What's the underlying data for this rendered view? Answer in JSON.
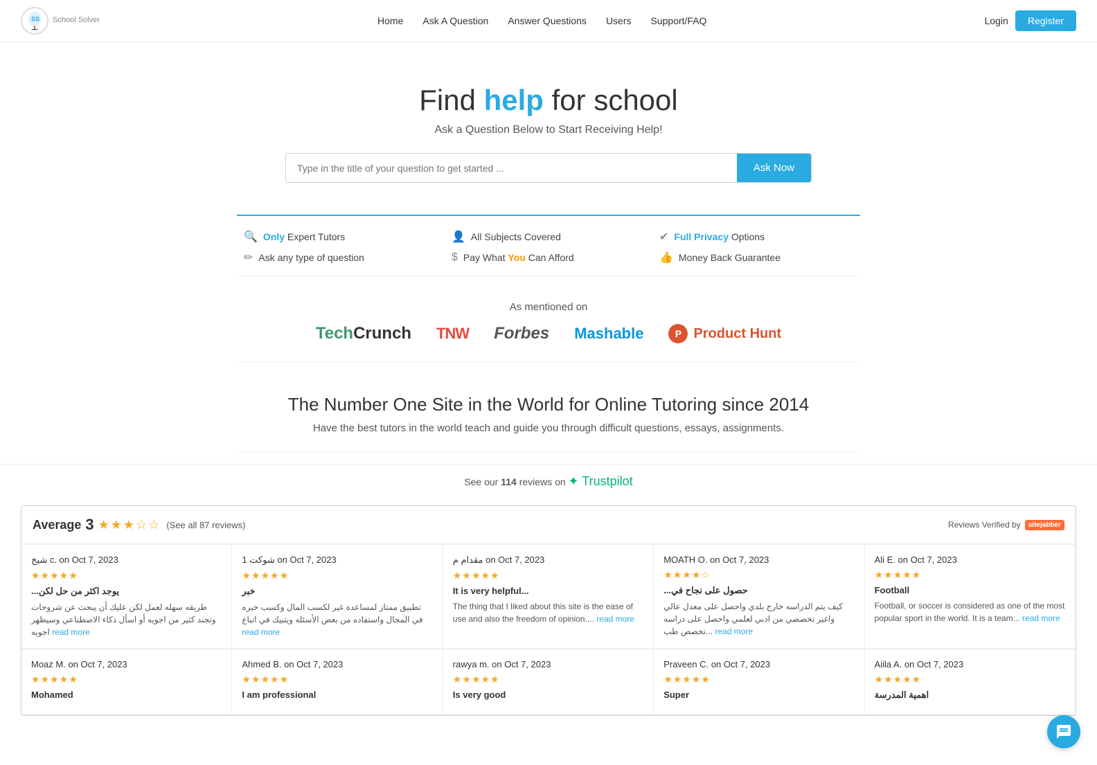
{
  "nav": {
    "logo_text": "School Solver",
    "links": [
      "Home",
      "Ask A Question",
      "Answer Questions",
      "Users",
      "Support/FAQ"
    ],
    "login_label": "Login",
    "register_label": "Register"
  },
  "hero": {
    "headline_prefix": "Find ",
    "headline_highlight": "help",
    "headline_suffix": " for school",
    "subtext": "Ask a Question Below to Start Receiving Help!",
    "search_placeholder": "Type in the title of your question to get started ...",
    "ask_button": "Ask Now"
  },
  "features": [
    {
      "icon": "🔍",
      "text_before": "",
      "highlight": "Only",
      "text_after": " Expert Tutors",
      "highlight_class": "feat-highlight"
    },
    {
      "icon": "👤",
      "text_before": "All Subjects Covered",
      "highlight": "",
      "text_after": "",
      "highlight_class": ""
    },
    {
      "icon": "✔",
      "text_before": "",
      "highlight": "Full Privacy",
      "text_after": " Options",
      "highlight_class": "feat-highlight"
    },
    {
      "icon": "✏",
      "text_before": "Ask any type of question",
      "highlight": "",
      "text_after": "",
      "highlight_class": ""
    },
    {
      "icon": "$",
      "text_before": "Pay What ",
      "highlight": "You",
      "text_after": " Can Afford",
      "highlight_class": "feat-highlight-orange"
    },
    {
      "icon": "👍",
      "text_before": "Money Back Guarantee",
      "highlight": "",
      "text_after": "",
      "highlight_class": ""
    }
  ],
  "mentioned": {
    "label": "As mentioned on",
    "logos": {
      "techcrunch": {
        "part1": "Tech",
        "part2": "Crunch"
      },
      "tnw": "TNW",
      "forbes": "Forbes",
      "mashable": "Mashable",
      "producthunt": {
        "letter": "P",
        "text": "Product Hunt"
      }
    }
  },
  "tagline": {
    "heading": "The Number One Site in the World for Online Tutoring since 2014",
    "subtext": "Have the best tutors in the world teach and guide you through difficult questions, essays, assignments."
  },
  "trustpilot": {
    "label": "See our",
    "count": "114",
    "label2": "reviews on",
    "platform": "✦ Trustpilot"
  },
  "reviews_header": {
    "avg_label": "Average",
    "avg_score": "3",
    "stars": "★★★☆☆",
    "see_all": "(See all 87 reviews)",
    "verified_label": "Reviews Verified by",
    "sj_label": "sitejabber"
  },
  "review_rows": [
    [
      {
        "name": "شيخ c. on Oct 7, 2023",
        "stars": "★★★★★",
        "title": "...يوجد اكثر من حل لكن",
        "body": "طريقه سهله لعمل لكن عليك أن يبحث عن شروحات وتجند كثير من اجويه أو اسأل ذكاء الاصطناعي وسيظهر اجويه",
        "read_more": "read more"
      },
      {
        "name": "شوكت 1 on Oct 7, 2023",
        "stars": "★★★★★",
        "title": "خبر",
        "body": "تطبيق ممتاز لمساعدة غير لكسب المال وكسب خبره في المجال واستفاده من بعض الأسئله ويتبيك في اتباع",
        "read_more": "read more"
      },
      {
        "name": "مقدام م on Oct 7, 2023",
        "stars": "★★★★★",
        "title": "It is very helpful...",
        "body": "The thing that I liked about this site is the ease of use and also the freedom of opinion....",
        "read_more": "read more"
      },
      {
        "name": "MOATH O. on Oct 7, 2023",
        "stars": "★★★★☆",
        "title": "...حصول على نجاح في",
        "body": "كيف يتم الدراسه خارج بلدي واحصل على معدل عالي واغير تخصصي من ادبي لعلمي واحصل على دراسه ...تخصص طب",
        "read_more": "read more"
      },
      {
        "name": "Ali E. on Oct 7, 2023",
        "stars": "★★★★★",
        "title": "Football",
        "body": "Football, or soccer is considered as one of the most popular sport in the world. It is a team...",
        "read_more": "read more"
      }
    ],
    [
      {
        "name": "Moaz M. on Oct 7, 2023",
        "stars": "★★★★★",
        "title": "Mohamed",
        "body": "",
        "read_more": ""
      },
      {
        "name": "Ahmed B. on Oct 7, 2023",
        "stars": "★★★★★",
        "title": "I am professional",
        "body": "",
        "read_more": ""
      },
      {
        "name": "rawya m. on Oct 7, 2023",
        "stars": "★★★★★",
        "title": "Is very good",
        "body": "",
        "read_more": ""
      },
      {
        "name": "Praveen C. on Oct 7, 2023",
        "stars": "★★★★★",
        "title": "Super",
        "body": "",
        "read_more": ""
      },
      {
        "name": "Aiila A. on Oct 7, 2023",
        "stars": "★★★★★",
        "title": "اهمية المدرسة",
        "body": "",
        "read_more": ""
      }
    ]
  ]
}
